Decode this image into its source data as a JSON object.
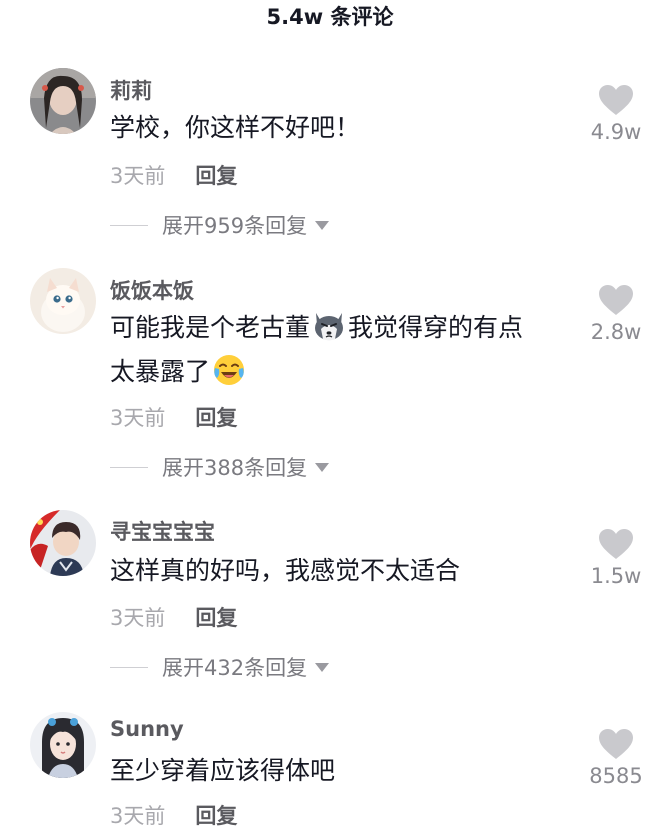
{
  "header": {
    "title": "5.4w 条评论"
  },
  "colors": {
    "heart": "#c9c9cd",
    "username": "#5a5a5f",
    "meta": "#a8a8ad"
  },
  "comments": [
    {
      "username": "莉莉",
      "text": "学校，你这样不好吧！",
      "time": "3天前",
      "reply_label": "回复",
      "expand_label": "展开959条回复",
      "likes": "4.9w"
    },
    {
      "username": "饭饭本饭",
      "text_part1": "可能我是个老古董",
      "text_part2": "我觉得穿的有点",
      "text_part3": "太暴露了",
      "emoji1": "husky-emoji",
      "emoji2": "laughing-crying-emoji",
      "time": "3天前",
      "reply_label": "回复",
      "expand_label": "展开388条回复",
      "likes": "2.8w"
    },
    {
      "username": "寻宝宝宝宝",
      "text": "这样真的好吗，我感觉不太适合",
      "time": "3天前",
      "reply_label": "回复",
      "expand_label": "展开432条回复",
      "likes": "1.5w"
    },
    {
      "username": "Sunny",
      "text": "至少穿着应该得体吧",
      "time": "3天前",
      "reply_label": "回复",
      "likes": "8585"
    }
  ]
}
